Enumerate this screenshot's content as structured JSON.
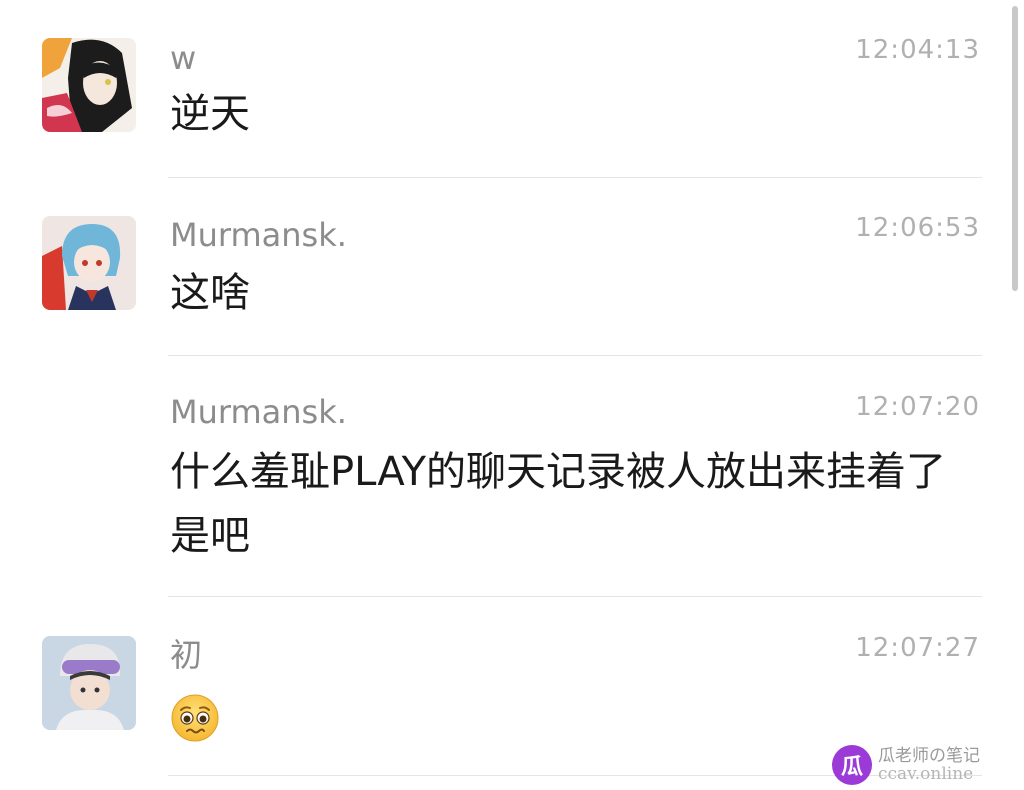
{
  "messages": [
    {
      "sender": "w",
      "time": "12:04:13",
      "text": "逆天"
    },
    {
      "sender": "Murmansk.",
      "time": "12:06:53",
      "text": "这啥"
    },
    {
      "sender": "Murmansk.",
      "time": "12:07:20",
      "text": "什么羞耻PLAY的聊天记录被人放出来挂着了是吧"
    },
    {
      "sender": "初",
      "time": "12:07:27",
      "text": "",
      "emoji": "pleading-face-icon"
    }
  ],
  "watermark": {
    "logo_char": "瓜",
    "line1": "瓜老师の笔记",
    "line2": "ccav.online"
  },
  "colors": {
    "sender": "#8c8c8c",
    "time": "#b0b0b0",
    "text": "#1a1a1a",
    "divider": "#e4e4e4",
    "watermark_accent": "#9b3ad6"
  }
}
